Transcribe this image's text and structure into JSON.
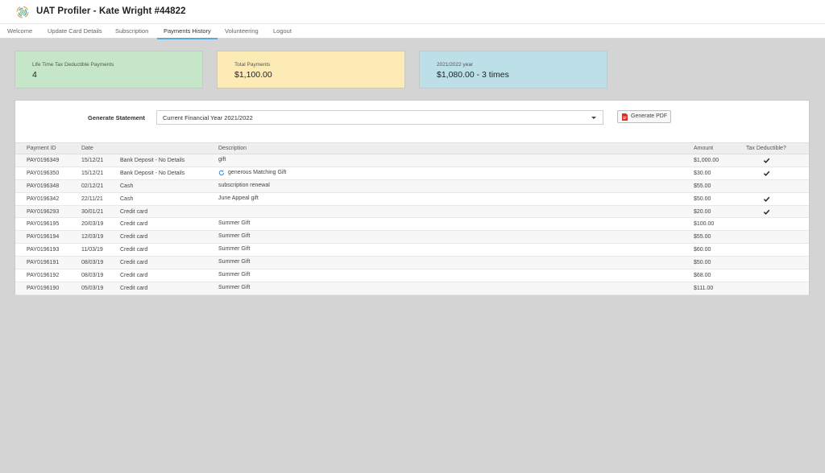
{
  "app": {
    "title": "UAT Profiler - Kate Wright #44822",
    "logo_icon": "colorful-swirl-logo"
  },
  "nav": {
    "tabs": [
      {
        "label": "Welcome",
        "active": false
      },
      {
        "label": "Update Card Details",
        "active": false
      },
      {
        "label": "Subscription",
        "active": false
      },
      {
        "label": "Payments History",
        "active": true
      },
      {
        "label": "Volunteering",
        "active": false
      },
      {
        "label": "Logout",
        "active": false
      }
    ]
  },
  "cards": [
    {
      "label": "Life Time Tax Deductible Payments",
      "value": "4",
      "color": "#c6e6ca"
    },
    {
      "label": "Total Payments",
      "value": "$1,100.00",
      "color": "#fcebb5"
    },
    {
      "label": "2021/2022 year",
      "value": "$1,080.00 - 3 times",
      "color": "#bde0e8"
    }
  ],
  "statement": {
    "label": "Generate Statement",
    "selected": "Current Financial Year 2021/2022",
    "button_label": "Generate PDF",
    "button_icon": "pdf-file-icon"
  },
  "table": {
    "headers": {
      "id": "Payment ID",
      "date": "Date",
      "description": "Description",
      "amount": "Amount",
      "tax": "Tax Deductible?"
    },
    "rows": [
      {
        "id": "PAY0196349",
        "date": "15/12/21",
        "type": "Bank Deposit - No Details",
        "description": "gift",
        "recurring": false,
        "amount": "$1,000.00",
        "tax": true
      },
      {
        "id": "PAY0196350",
        "date": "15/12/21",
        "type": "Bank Deposit - No Details",
        "description": "generous Matching Gift",
        "recurring": true,
        "amount": "$30.00",
        "tax": true
      },
      {
        "id": "PAY0196348",
        "date": "02/12/21",
        "type": "Cash",
        "description": "subscription renewal",
        "recurring": false,
        "amount": "$55.00",
        "tax": false
      },
      {
        "id": "PAY0196342",
        "date": "22/11/21",
        "type": "Cash",
        "description": "June Appeal gift",
        "recurring": false,
        "amount": "$50.00",
        "tax": true
      },
      {
        "id": "PAY0196293",
        "date": "30/01/21",
        "type": "Credit card",
        "description": "",
        "recurring": false,
        "amount": "$20.00",
        "tax": true
      },
      {
        "id": "PAY0196195",
        "date": "20/03/19",
        "type": "Credit card",
        "description": "Summer Gift",
        "recurring": false,
        "amount": "$100.00",
        "tax": false
      },
      {
        "id": "PAY0196194",
        "date": "12/03/19",
        "type": "Credit card",
        "description": "Summer Gift",
        "recurring": false,
        "amount": "$55.00",
        "tax": false
      },
      {
        "id": "PAY0196193",
        "date": "11/03/19",
        "type": "Credit card",
        "description": "Summer Gift",
        "recurring": false,
        "amount": "$60.00",
        "tax": false
      },
      {
        "id": "PAY0196191",
        "date": "08/03/19",
        "type": "Credit card",
        "description": "Summer Gift",
        "recurring": false,
        "amount": "$50.00",
        "tax": false
      },
      {
        "id": "PAY0196192",
        "date": "08/03/19",
        "type": "Credit card",
        "description": "Summer Gift",
        "recurring": false,
        "amount": "$68.00",
        "tax": false
      },
      {
        "id": "PAY0196190",
        "date": "05/03/19",
        "type": "Credit card",
        "description": "Summer Gift",
        "recurring": false,
        "amount": "$111.00",
        "tax": false
      }
    ]
  }
}
